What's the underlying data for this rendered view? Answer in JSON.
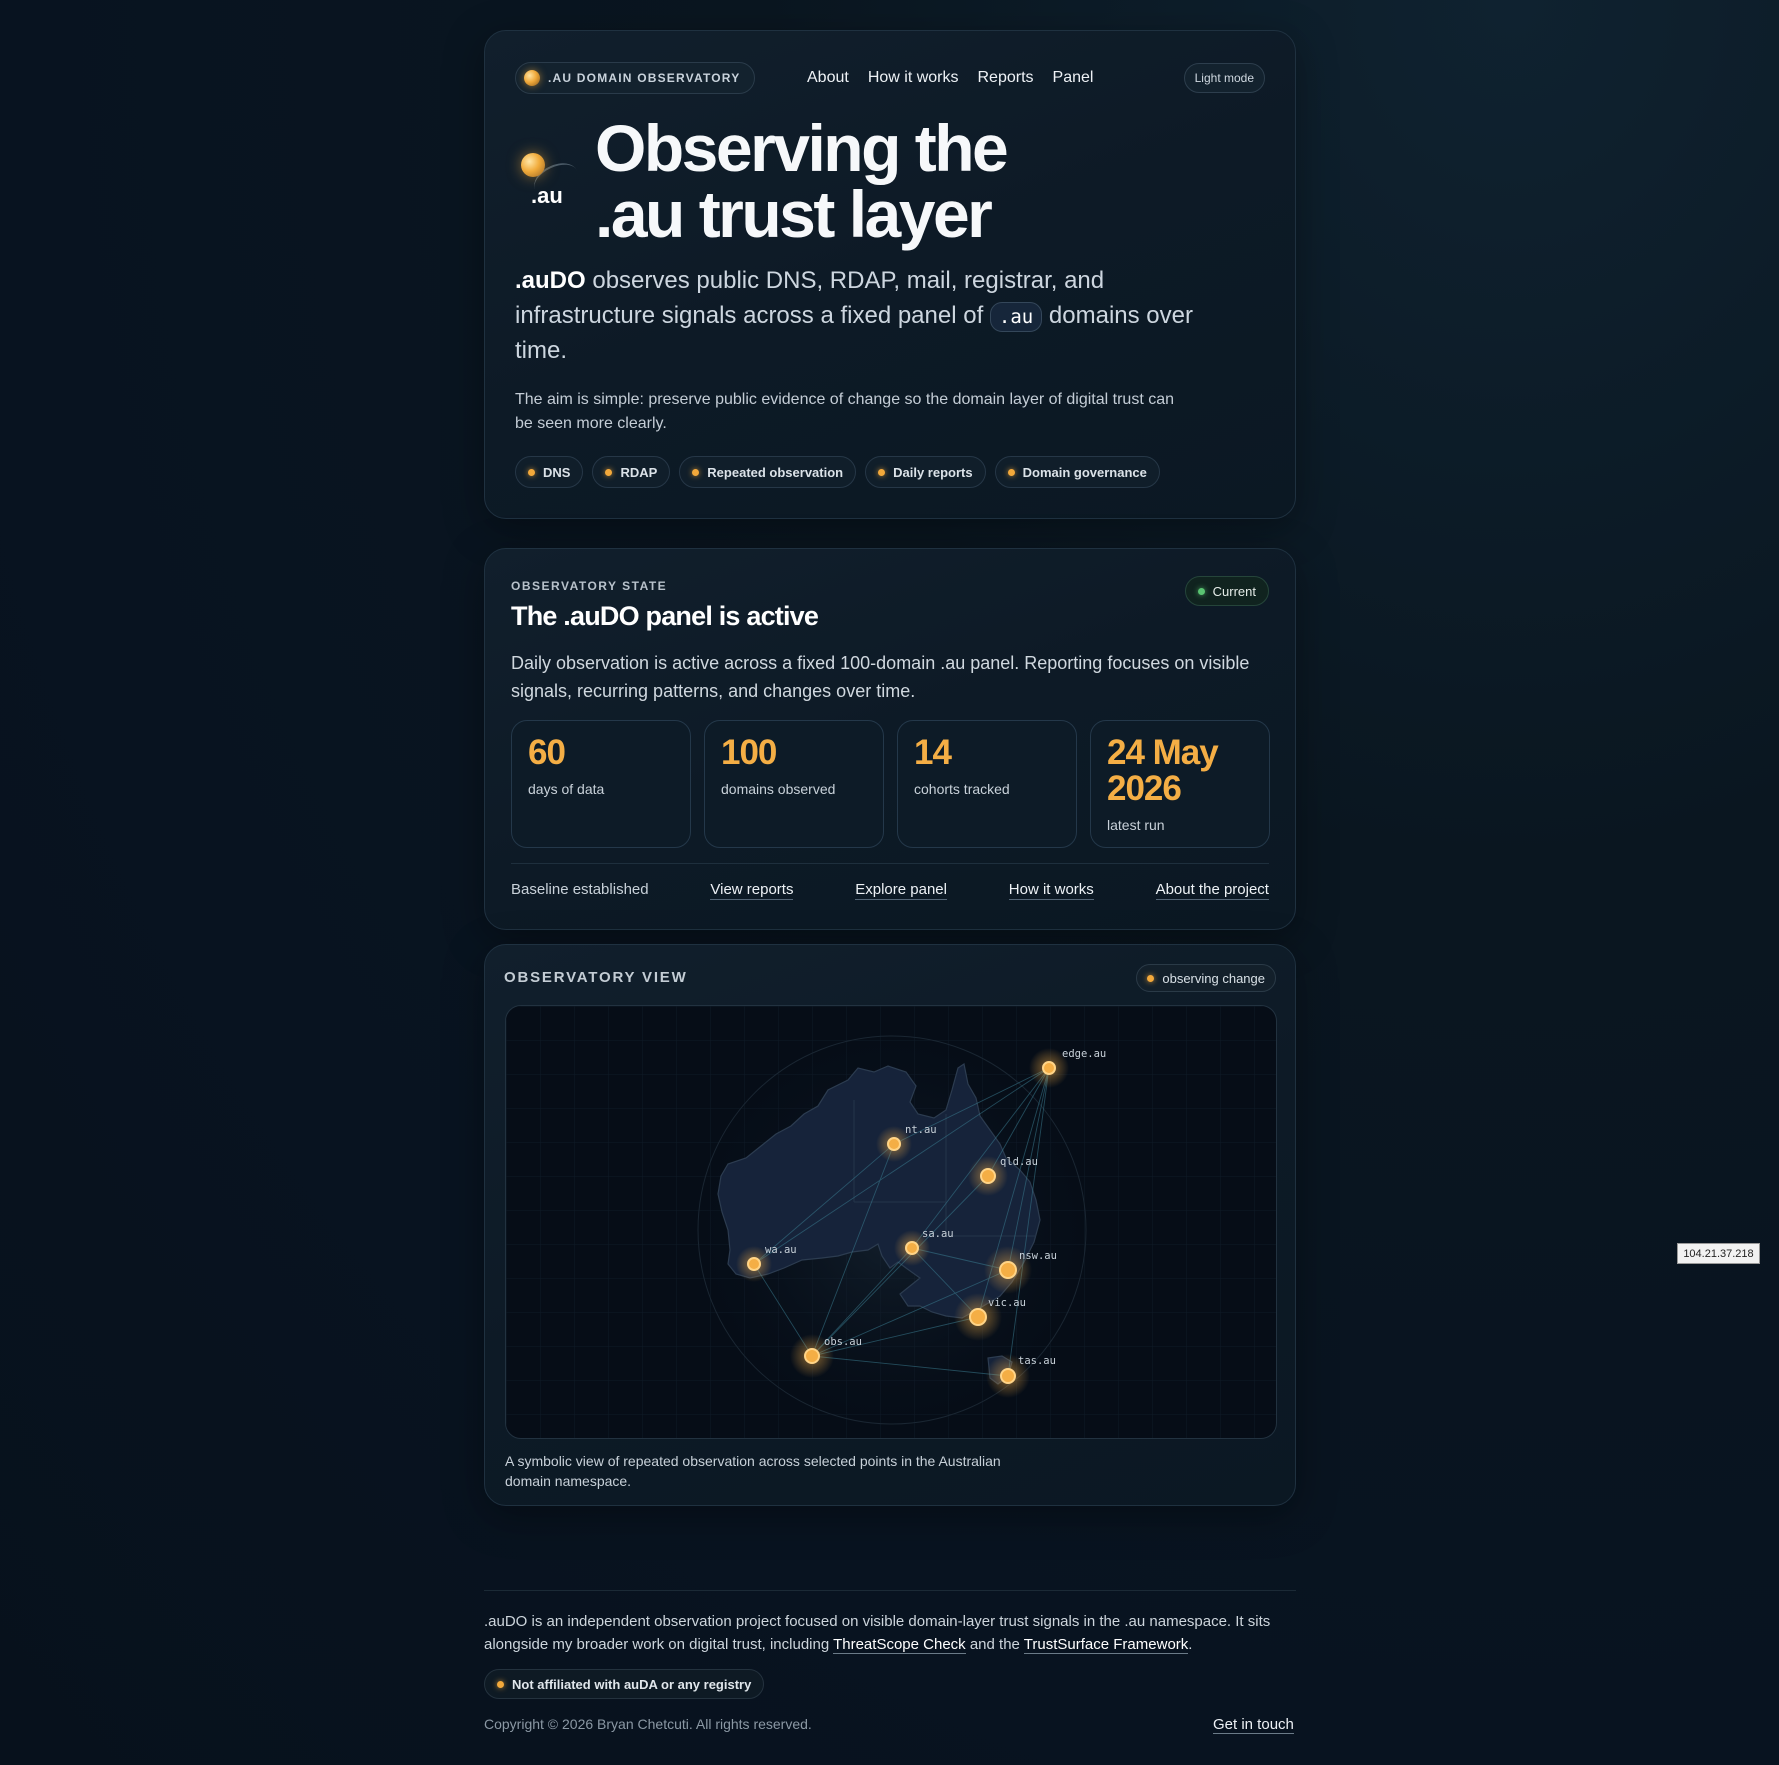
{
  "nav": {
    "brand": ".AU DOMAIN OBSERVATORY",
    "items": [
      {
        "label": "About"
      },
      {
        "label": "How it works"
      },
      {
        "label": "Reports"
      },
      {
        "label": "Panel"
      }
    ],
    "theme_toggle": "Light mode"
  },
  "hero": {
    "logo_text": ".au",
    "title_line1": "Observing the",
    "title_line2": ".au trust layer",
    "lead_strong": ".auDO",
    "lead_part1": " observes public DNS, RDAP, mail, registrar, and infrastructure signals across a fixed panel of ",
    "lead_code": ".au",
    "lead_part2": " domains over time.",
    "aim": "The aim is simple: preserve public evidence of change so the domain layer of digital trust can be seen more clearly.",
    "tags": [
      "DNS",
      "RDAP",
      "Repeated observation",
      "Daily reports",
      "Domain governance"
    ]
  },
  "state": {
    "eyebrow": "OBSERVATORY STATE",
    "title": "The .auDO panel is active",
    "status": "Current",
    "description": "Daily observation is active across a fixed 100-domain .au panel. Reporting focuses on visible signals, recurring patterns, and changes over time.",
    "stats": [
      {
        "value": "60",
        "label": "days of data"
      },
      {
        "value": "100",
        "label": "domains observed"
      },
      {
        "value": "14",
        "label": "cohorts tracked"
      },
      {
        "value": "24 May 2026",
        "label": "latest run"
      }
    ],
    "baseline": "Baseline established",
    "links": [
      "View reports",
      "Explore panel",
      "How it works",
      "About the project"
    ]
  },
  "view": {
    "title": "OBSERVATORY VIEW",
    "badge": "observing change",
    "nodes": [
      "edge.au",
      "nt.au",
      "qld.au",
      "sa.au",
      "wa.au",
      "nsw.au",
      "vic.au",
      "obs.au",
      "tas.au"
    ],
    "caption": "A symbolic view of repeated observation across selected points in the Australian domain namespace."
  },
  "footer": {
    "text_part1": ".auDO is an independent observation project focused on visible domain-layer trust signals in the .au namespace. It sits alongside my broader work on digital trust, including ",
    "link1": "ThreatScope Check",
    "text_part2": " and the ",
    "link2": "TrustSurface Framework",
    "text_part3": ".",
    "affiliation": "Not affiliated with auDA or any registry",
    "copyright": "Copyright © 2026 Bryan Chetcuti. All rights reserved.",
    "contact": "Get in touch"
  },
  "ip_badge": "104.21.37.218",
  "colors": {
    "accent": "#f4ae45",
    "status_green": "#5ac472",
    "background": "#081320"
  }
}
